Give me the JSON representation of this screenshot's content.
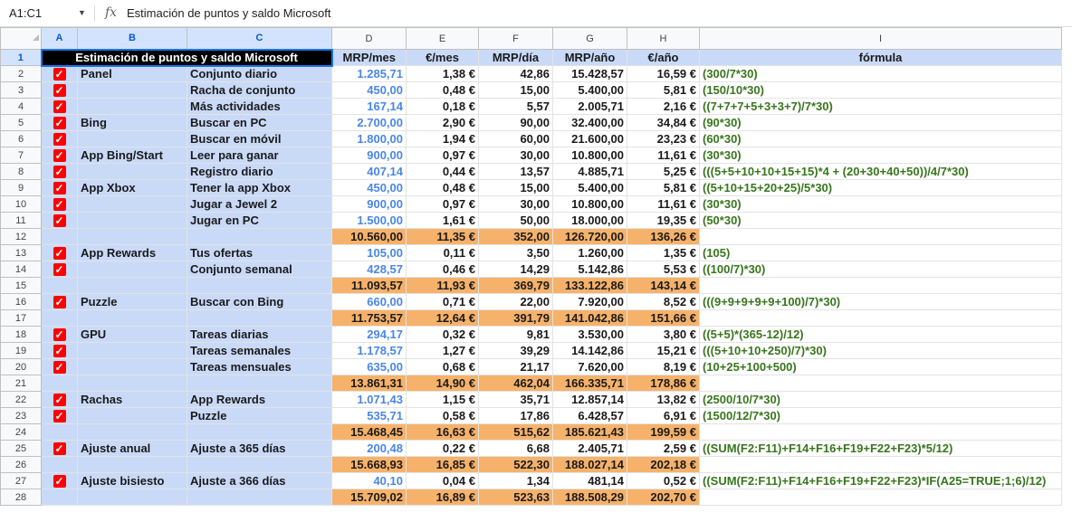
{
  "formula_bar": {
    "name_box": "A1:C1",
    "fx_label": "fx",
    "content": "Estimación de puntos y saldo Microsoft"
  },
  "columns": [
    "A",
    "B",
    "C",
    "D",
    "E",
    "F",
    "G",
    "H",
    "I"
  ],
  "rows": [
    {
      "n": "1",
      "b": "",
      "c": "",
      "title": "Estimación de puntos y saldo Microsoft",
      "d": "MRP/mes",
      "e": "€/mes",
      "f": "MRP/día",
      "g": "MRP/año",
      "h": "€/año",
      "i": "fórmula",
      "kind": "header"
    },
    {
      "n": "2",
      "check": true,
      "b": "Panel",
      "c": "Conjunto diario",
      "d": "1.285,71",
      "e": "1,38 €",
      "f": "42,86",
      "g": "15.428,57",
      "h": "16,59 €",
      "i": "(300/7*30)",
      "kind": "data"
    },
    {
      "n": "3",
      "check": true,
      "b": "",
      "c": "Racha de conjunto",
      "d": "450,00",
      "e": "0,48 €",
      "f": "15,00",
      "g": "5.400,00",
      "h": "5,81 €",
      "i": "(150/10*30)",
      "kind": "data"
    },
    {
      "n": "4",
      "check": true,
      "b": "",
      "c": "Más actividades",
      "d": "167,14",
      "e": "0,18 €",
      "f": "5,57",
      "g": "2.005,71",
      "h": "2,16 €",
      "i": "((7+7+7+5+3+3+7)/7*30)",
      "kind": "data"
    },
    {
      "n": "5",
      "check": true,
      "b": "Bing",
      "c": "Buscar en PC",
      "d": "2.700,00",
      "e": "2,90 €",
      "f": "90,00",
      "g": "32.400,00",
      "h": "34,84 €",
      "i": "(90*30)",
      "kind": "data"
    },
    {
      "n": "6",
      "check": true,
      "b": "",
      "c": "Buscar en móvil",
      "d": "1.800,00",
      "e": "1,94 €",
      "f": "60,00",
      "g": "21.600,00",
      "h": "23,23 €",
      "i": "(60*30)",
      "kind": "data"
    },
    {
      "n": "7",
      "check": true,
      "b": "App Bing/Start",
      "c": "Leer para ganar",
      "d": "900,00",
      "e": "0,97 €",
      "f": "30,00",
      "g": "10.800,00",
      "h": "11,61 €",
      "i": "(30*30)",
      "kind": "data"
    },
    {
      "n": "8",
      "check": true,
      "b": "",
      "c": "Registro diario",
      "d": "407,14",
      "e": "0,44 €",
      "f": "13,57",
      "g": "4.885,71",
      "h": "5,25 €",
      "i": "(((5+5+10+10+15+15)*4 + (20+30+40+50))/4/7*30)",
      "kind": "data"
    },
    {
      "n": "9",
      "check": true,
      "b": "App Xbox",
      "c": "Tener la app Xbox",
      "d": "450,00",
      "e": "0,48 €",
      "f": "15,00",
      "g": "5.400,00",
      "h": "5,81 €",
      "i": "((5+10+15+20+25)/5*30)",
      "kind": "data"
    },
    {
      "n": "10",
      "check": true,
      "b": "",
      "c": "Jugar a Jewel 2",
      "d": "900,00",
      "e": "0,97 €",
      "f": "30,00",
      "g": "10.800,00",
      "h": "11,61 €",
      "i": "(30*30)",
      "kind": "data"
    },
    {
      "n": "11",
      "check": true,
      "b": "",
      "c": "Jugar en PC",
      "d": "1.500,00",
      "e": "1,61 €",
      "f": "50,00",
      "g": "18.000,00",
      "h": "19,35 €",
      "i": "(50*30)",
      "kind": "data"
    },
    {
      "n": "12",
      "check": false,
      "b": "",
      "c": "",
      "d": "10.560,00",
      "e": "11,35 €",
      "f": "352,00",
      "g": "126.720,00",
      "h": "136,26 €",
      "i": "",
      "kind": "total"
    },
    {
      "n": "13",
      "check": true,
      "b": "App Rewards",
      "c": "Tus ofertas",
      "d": "105,00",
      "e": "0,11 €",
      "f": "3,50",
      "g": "1.260,00",
      "h": "1,35 €",
      "i": "(105)",
      "kind": "data"
    },
    {
      "n": "14",
      "check": true,
      "b": "",
      "c": "Conjunto semanal",
      "d": "428,57",
      "e": "0,46 €",
      "f": "14,29",
      "g": "5.142,86",
      "h": "5,53 €",
      "i": "((100/7)*30)",
      "kind": "data"
    },
    {
      "n": "15",
      "check": false,
      "b": "",
      "c": "",
      "d": "11.093,57",
      "e": "11,93 €",
      "f": "369,79",
      "g": "133.122,86",
      "h": "143,14 €",
      "i": "",
      "kind": "total"
    },
    {
      "n": "16",
      "check": true,
      "b": "Puzzle",
      "c": "Buscar con Bing",
      "d": "660,00",
      "e": "0,71 €",
      "f": "22,00",
      "g": "7.920,00",
      "h": "8,52 €",
      "i": "(((9+9+9+9+9+100)/7)*30)",
      "kind": "data"
    },
    {
      "n": "17",
      "check": false,
      "b": "",
      "c": "",
      "d": "11.753,57",
      "e": "12,64 €",
      "f": "391,79",
      "g": "141.042,86",
      "h": "151,66 €",
      "i": "",
      "kind": "total"
    },
    {
      "n": "18",
      "check": true,
      "b": "GPU",
      "c": "Tareas diarias",
      "d": "294,17",
      "e": "0,32 €",
      "f": "9,81",
      "g": "3.530,00",
      "h": "3,80 €",
      "i": "((5+5)*(365-12)/12)",
      "kind": "data"
    },
    {
      "n": "19",
      "check": true,
      "b": "",
      "c": "Tareas semanales",
      "d": "1.178,57",
      "e": "1,27 €",
      "f": "39,29",
      "g": "14.142,86",
      "h": "15,21 €",
      "i": "(((5+10+10+250)/7)*30)",
      "kind": "data"
    },
    {
      "n": "20",
      "check": true,
      "b": "",
      "c": "Tareas mensuales",
      "d": "635,00",
      "e": "0,68 €",
      "f": "21,17",
      "g": "7.620,00",
      "h": "8,19 €",
      "i": "(10+25+100+500)",
      "kind": "data"
    },
    {
      "n": "21",
      "check": false,
      "b": "",
      "c": "",
      "d": "13.861,31",
      "e": "14,90 €",
      "f": "462,04",
      "g": "166.335,71",
      "h": "178,86 €",
      "i": "",
      "kind": "total"
    },
    {
      "n": "22",
      "check": true,
      "b": "Rachas",
      "c": "App Rewards",
      "d": "1.071,43",
      "e": "1,15 €",
      "f": "35,71",
      "g": "12.857,14",
      "h": "13,82 €",
      "i": "(2500/10/7*30)",
      "kind": "data"
    },
    {
      "n": "23",
      "check": true,
      "b": "",
      "c": "Puzzle",
      "d": "535,71",
      "e": "0,58 €",
      "f": "17,86",
      "g": "6.428,57",
      "h": "6,91 €",
      "i": "(1500/12/7*30)",
      "kind": "data"
    },
    {
      "n": "24",
      "check": false,
      "b": "",
      "c": "",
      "d": "15.468,45",
      "e": "16,63 €",
      "f": "515,62",
      "g": "185.621,43",
      "h": "199,59 €",
      "i": "",
      "kind": "total"
    },
    {
      "n": "25",
      "check": true,
      "b": "Ajuste anual",
      "c": "Ajuste a 365 días",
      "d": "200,48",
      "e": "0,22 €",
      "f": "6,68",
      "g": "2.405,71",
      "h": "2,59 €",
      "i": "((SUM(F2:F11)+F14+F16+F19+F22+F23)*5/12)",
      "kind": "data"
    },
    {
      "n": "26",
      "check": false,
      "b": "",
      "c": "",
      "d": "15.668,93",
      "e": "16,85 €",
      "f": "522,30",
      "g": "188.027,14",
      "h": "202,18 €",
      "i": "",
      "kind": "total"
    },
    {
      "n": "27",
      "check": true,
      "b": "Ajuste bisiesto",
      "c": "Ajuste a 366 días",
      "d": "40,10",
      "e": "0,04 €",
      "f": "1,34",
      "g": "481,14",
      "h": "0,52 €",
      "i": "((SUM(F2:F11)+F14+F16+F19+F22+F23)*IF(A25=TRUE;1;6)/12)",
      "kind": "data"
    },
    {
      "n": "28",
      "check": false,
      "b": "",
      "c": "",
      "d": "15.709,02",
      "e": "16,89 €",
      "f": "523,63",
      "g": "188.508,29",
      "h": "202,70 €",
      "i": "",
      "kind": "total"
    }
  ],
  "colors": {
    "checkbox": "#ff0000",
    "total_fill": "#f6b26b",
    "label_fill": "#c9daf8",
    "mrp_text": "#4a86e8",
    "formula_text": "#38761d"
  }
}
